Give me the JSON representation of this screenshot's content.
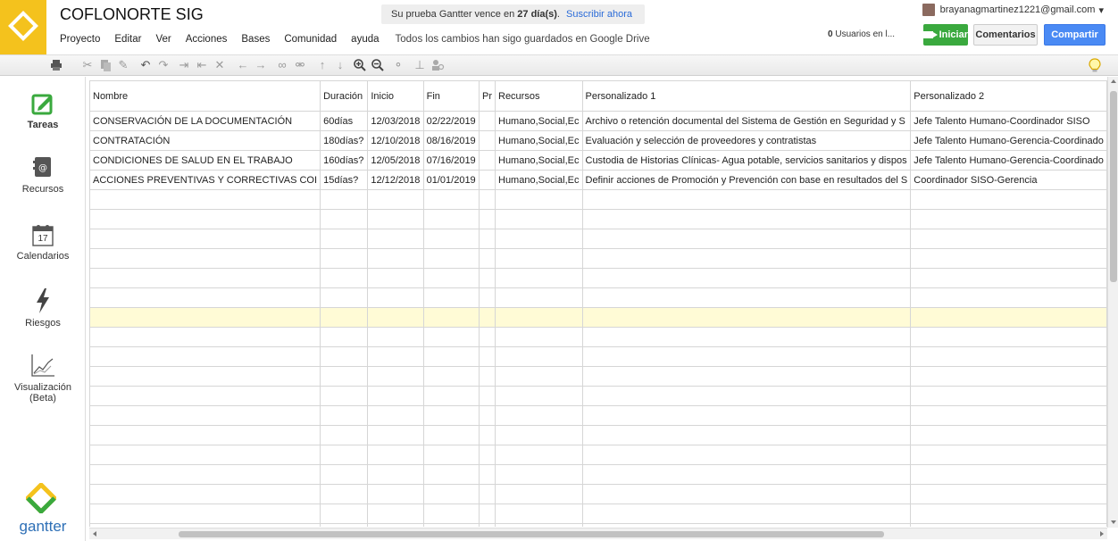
{
  "app": {
    "title": "COFLONORTE SIG",
    "brand_color": "#f4c21d"
  },
  "menu": {
    "items": [
      "Proyecto",
      "Editar",
      "Ver",
      "Acciones",
      "Bases",
      "Comunidad",
      "ayuda"
    ],
    "save_status": "Todos los cambios han sigo guardados en Google Drive"
  },
  "trial": {
    "prefix": "Su prueba Gantter vence en",
    "days": "27 día(s)",
    "suffix": ".",
    "link": "Suscribir ahora"
  },
  "user": {
    "email": "brayanagmartinez1221@gmail.com",
    "dropdown": "▾",
    "users_count": "0",
    "users_label": "Usuarios en l..."
  },
  "buttons": {
    "start": "Iniciar",
    "comments": "Comentarios",
    "share": "Compartir",
    "start_color": "#3aa93e",
    "share_color": "#4a8af4"
  },
  "toolbar": {
    "icons": [
      "print-icon",
      "cut-icon",
      "copy-icon",
      "paste-icon",
      "undo-icon",
      "redo-icon",
      "indent-icon",
      "outdent-icon",
      "delete-icon",
      "move-left-icon",
      "move-right-icon",
      "link-icon",
      "unlink-icon",
      "move-up-icon",
      "move-down-icon",
      "zoom-in-icon",
      "zoom-out-icon",
      "split-icon",
      "assign-resource-icon",
      "resource-group-icon",
      "lightbulb-icon"
    ]
  },
  "sidebar": {
    "items": [
      {
        "label": "Tareas",
        "icon": "tasks-icon"
      },
      {
        "label": "Recursos",
        "icon": "resources-icon"
      },
      {
        "label": "Calendarios",
        "icon": "calendar-icon",
        "icon_text": "17"
      },
      {
        "label": "Riesgos",
        "icon": "risks-icon"
      },
      {
        "label": "Visualización (Beta)",
        "icon": "visualization-icon"
      }
    ],
    "logo_text": "gantter"
  },
  "grid": {
    "columns": [
      "Nombre",
      "Duración",
      "Inicio",
      "Fin",
      "Pr",
      "Recursos",
      "Personalizado 1",
      "Personalizado 2"
    ],
    "rows": [
      [
        "CONSERVACIÓN DE LA DOCUMENTACIÓN",
        "60días",
        "12/03/2018",
        "02/22/2019",
        "",
        "Humano,Social,Ec",
        "Archivo o retención documental del Sistema de Gestión en Seguridad y S",
        "Jefe Talento Humano-Coordinador SISO"
      ],
      [
        "CONTRATACIÓN",
        "180días?",
        "12/10/2018",
        "08/16/2019",
        "",
        "Humano,Social,Ec",
        "Evaluación y selección de proveedores y contratistas",
        "Jefe Talento Humano-Gerencia-Coordinado"
      ],
      [
        "CONDICIONES DE SALUD EN EL TRABAJO",
        "160días?",
        "12/05/2018",
        "07/16/2019",
        "",
        "Humano,Social,Ec",
        "Custodia de Historias Clínicas- Agua potable, servicios sanitarios y dispos",
        "Jefe Talento Humano-Gerencia-Coordinado"
      ],
      [
        "ACCIONES PREVENTIVAS Y CORRECTIVAS COI",
        "15días?",
        "12/12/2018",
        "01/01/2019",
        "",
        "Humano,Social,Ec",
        "Definir acciones de Promoción y Prevención con base en resultados del S",
        "Coordinador SISO-Gerencia"
      ]
    ],
    "empty_rows": 18,
    "highlight_color": "#fffbd6"
  }
}
